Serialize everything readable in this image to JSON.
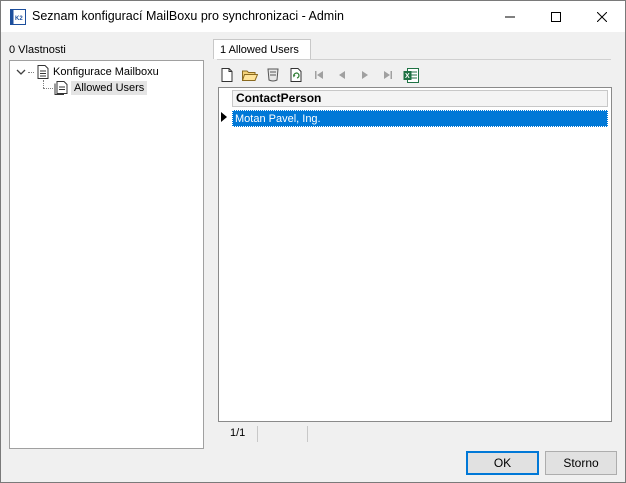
{
  "window": {
    "title": "Seznam konfigurací MailBoxu pro synchronizaci - Admin",
    "controls": {
      "minimize": "—",
      "maximize": "☐",
      "close": "✕"
    }
  },
  "left": {
    "label": "0 Vlastnosti",
    "tree": {
      "root_label": "Konfigurace Mailboxu",
      "child_label": "Allowed Users"
    }
  },
  "tab": {
    "label": "1 Allowed Users"
  },
  "toolbar": {
    "icons": [
      "new-icon",
      "open-folder-icon",
      "filter-icon",
      "refresh-icon",
      "first-record-icon",
      "previous-record-icon",
      "next-record-icon",
      "last-record-icon",
      "excel-export-icon"
    ]
  },
  "grid": {
    "columns": [
      "ContactPerson"
    ],
    "rows": [
      {
        "ContactPerson": "Motan Pavel, Ing."
      }
    ]
  },
  "status": {
    "position": "1/1"
  },
  "buttons": {
    "ok": "OK",
    "cancel": "Storno"
  },
  "colors": {
    "selection": "#0078d7",
    "ok_border": "#0078d7",
    "excel": "#1f7244"
  }
}
